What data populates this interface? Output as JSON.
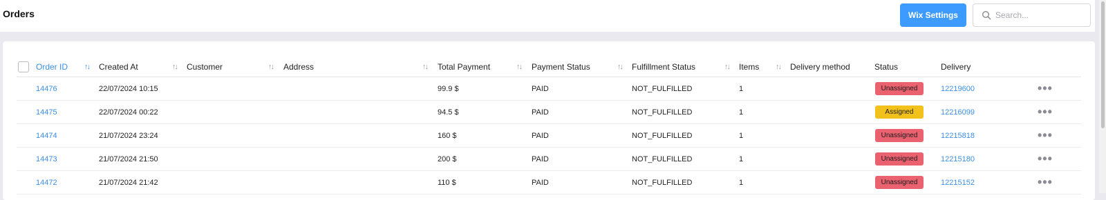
{
  "header": {
    "title": "Orders",
    "wix_settings_label": "Wix Settings",
    "search_placeholder": "Search...",
    "search_value": ""
  },
  "table": {
    "columns": [
      {
        "key": "order_id",
        "label": "Order ID",
        "sorted": true
      },
      {
        "key": "created_at",
        "label": "Created At"
      },
      {
        "key": "customer",
        "label": "Customer"
      },
      {
        "key": "address",
        "label": "Address"
      },
      {
        "key": "total_payment",
        "label": "Total Payment"
      },
      {
        "key": "payment_status",
        "label": "Payment Status"
      },
      {
        "key": "fulfillment_status",
        "label": "Fulfillment Status"
      },
      {
        "key": "items",
        "label": "Items"
      },
      {
        "key": "delivery_method",
        "label": "Delivery method"
      },
      {
        "key": "status",
        "label": "Status"
      },
      {
        "key": "delivery",
        "label": "Delivery"
      }
    ],
    "sort_glyph": "↑↓",
    "more_glyph": "•••",
    "rows": [
      {
        "order_id": "14476",
        "created_at": "22/07/2024 10:15",
        "customer": "",
        "address": "",
        "total_payment": "99.9 $",
        "payment_status": "PAID",
        "fulfillment_status": "NOT_FULFILLED",
        "items": "1",
        "delivery_method": "",
        "status": "Unassigned",
        "delivery": "12219600"
      },
      {
        "order_id": "14475",
        "created_at": "22/07/2024 00:22",
        "customer": "",
        "address": "",
        "total_payment": "94.5 $",
        "payment_status": "PAID",
        "fulfillment_status": "NOT_FULFILLED",
        "items": "1",
        "delivery_method": "",
        "status": "Assigned",
        "delivery": "12216099"
      },
      {
        "order_id": "14474",
        "created_at": "21/07/2024 23:24",
        "customer": "",
        "address": "",
        "total_payment": "160 $",
        "payment_status": "PAID",
        "fulfillment_status": "NOT_FULFILLED",
        "items": "1",
        "delivery_method": "",
        "status": "Unassigned",
        "delivery": "12215818"
      },
      {
        "order_id": "14473",
        "created_at": "21/07/2024 21:50",
        "customer": "",
        "address": "",
        "total_payment": "200 $",
        "payment_status": "PAID",
        "fulfillment_status": "NOT_FULFILLED",
        "items": "1",
        "delivery_method": "",
        "status": "Unassigned",
        "delivery": "12215180"
      },
      {
        "order_id": "14472",
        "created_at": "21/07/2024 21:42",
        "customer": "",
        "address": "",
        "total_payment": "110 $",
        "payment_status": "PAID",
        "fulfillment_status": "NOT_FULFILLED",
        "items": "1",
        "delivery_method": "",
        "status": "Unassigned",
        "delivery": "12215152"
      }
    ]
  },
  "colors": {
    "accent": "#3d9bff",
    "link": "#3a8fe6",
    "unassigned_badge": "#ea6170",
    "assigned_badge": "#f2c11b"
  },
  "icons": {
    "search": "search-icon",
    "sort": "sort-arrows-icon",
    "row_menu": "more-horizontal-icon",
    "select_all": "checkbox"
  }
}
